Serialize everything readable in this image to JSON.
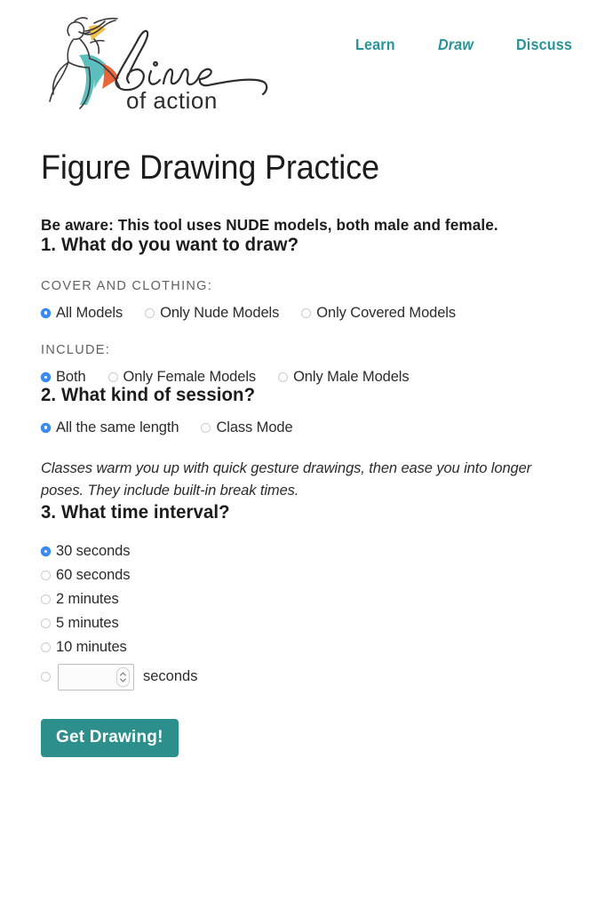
{
  "site": {
    "logo_word": "Line",
    "logo_subtitle": "of action",
    "logo_alt": "Line of Action dancer logo"
  },
  "nav": {
    "items": [
      {
        "label": "Learn",
        "active": false
      },
      {
        "label": "Draw",
        "active": true
      },
      {
        "label": "Discuss",
        "active": false
      }
    ]
  },
  "page": {
    "title": "Figure Drawing Practice",
    "warning": "Be aware: This tool uses NUDE models, both male and female."
  },
  "question1": {
    "heading": "1. What do you want to draw?",
    "cover_label": "COVER AND CLOTHING:",
    "cover_options": [
      {
        "label": "All Models",
        "checked": true
      },
      {
        "label": "Only Nude Models",
        "checked": false
      },
      {
        "label": "Only Covered Models",
        "checked": false
      }
    ],
    "include_label": "INCLUDE:",
    "include_options": [
      {
        "label": "Both",
        "checked": true
      },
      {
        "label": "Only Female Models",
        "checked": false
      },
      {
        "label": "Only Male Models",
        "checked": false
      }
    ]
  },
  "question2": {
    "heading": "2. What kind of session?",
    "options": [
      {
        "label": "All the same length",
        "checked": true
      },
      {
        "label": "Class Mode",
        "checked": false
      }
    ],
    "note": "Classes warm you up with quick gesture drawings, then ease you into longer poses. They include built-in break times."
  },
  "question3": {
    "heading": "3. What time interval?",
    "options": [
      {
        "label": "30 seconds",
        "checked": true
      },
      {
        "label": "60 seconds",
        "checked": false
      },
      {
        "label": "2 minutes",
        "checked": false
      },
      {
        "label": "5 minutes",
        "checked": false
      },
      {
        "label": "10 minutes",
        "checked": false
      }
    ],
    "custom": {
      "checked": false,
      "value": "",
      "placeholder": "",
      "unit_label": "seconds"
    }
  },
  "submit": {
    "label": "Get Drawing!"
  },
  "colors": {
    "accent_teal": "#2a9397",
    "button_teal": "#2c8f8c",
    "radio_blue": "#3b8efa",
    "label_gray": "#5d6166",
    "logo_teal": "#5dbfbd",
    "logo_orange": "#e8653a",
    "logo_yellow": "#f0c04a",
    "text": "#2b2b2b"
  }
}
